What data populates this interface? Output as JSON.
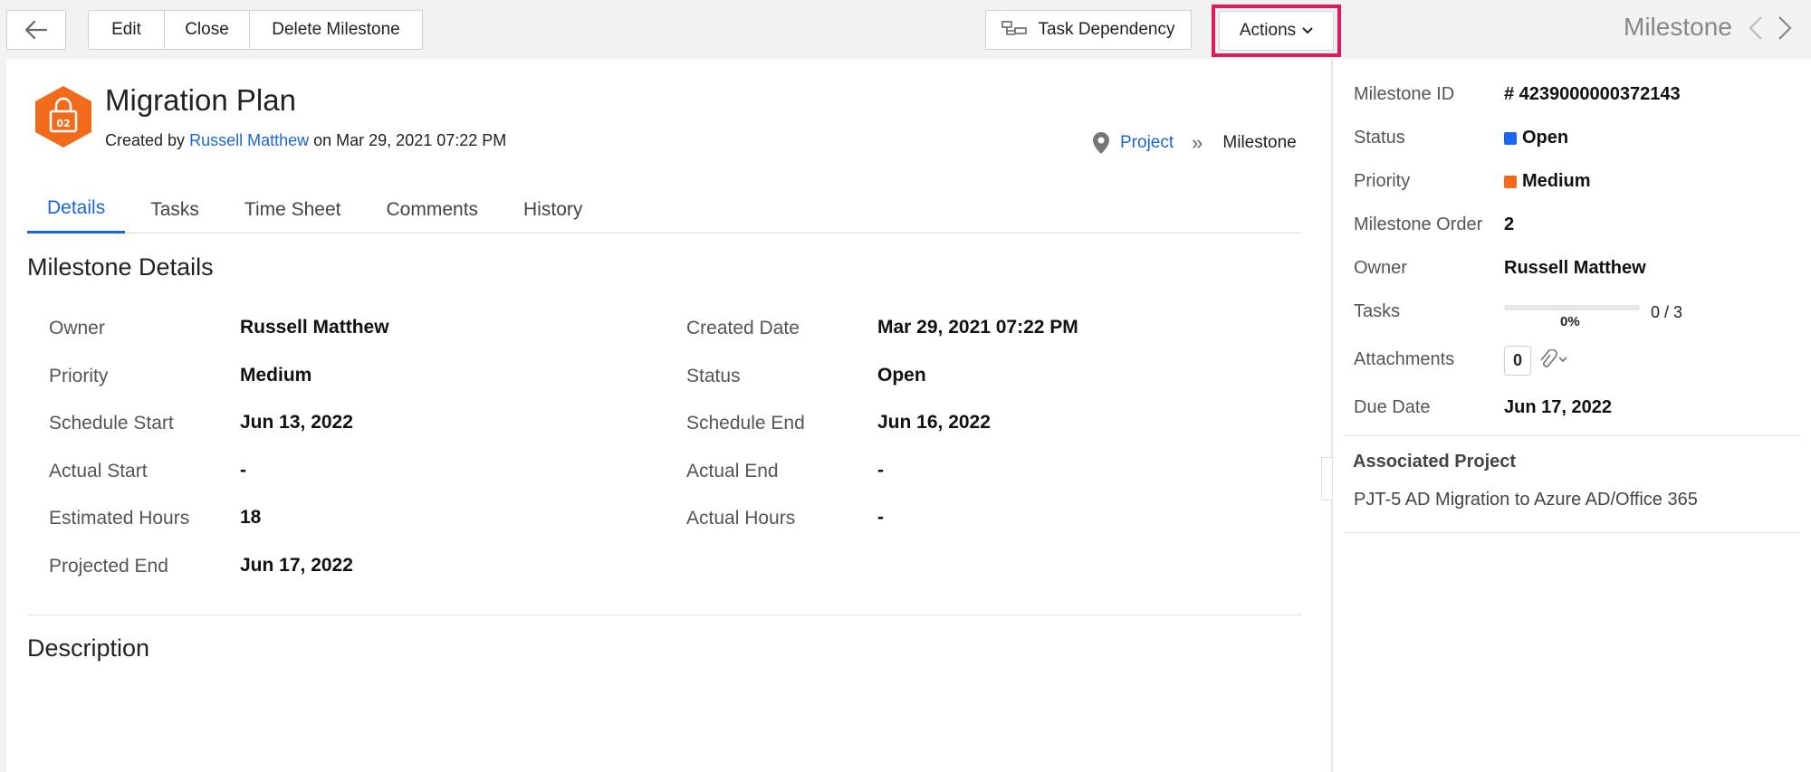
{
  "toolbar": {
    "edit_label": "Edit",
    "close_label": "Close",
    "delete_label": "Delete Milestone",
    "task_dependency_label": "Task Dependency",
    "actions_label": "Actions",
    "nav_title": "Milestone"
  },
  "header": {
    "logo_text": "02",
    "title": "Migration Plan",
    "created_prefix": "Created by",
    "created_by": "Russell Matthew",
    "created_suffix": "on Mar 29, 2021 07:22 PM",
    "breadcrumb_project": "Project",
    "breadcrumb_sep": "»",
    "breadcrumb_current": "Milestone"
  },
  "tabs": [
    {
      "label": "Details",
      "active": true
    },
    {
      "label": "Tasks"
    },
    {
      "label": "Time Sheet"
    },
    {
      "label": "Comments"
    },
    {
      "label": "History"
    }
  ],
  "details": {
    "section_title": "Milestone Details",
    "left": [
      {
        "label": "Owner",
        "value": "Russell Matthew"
      },
      {
        "label": "Priority",
        "value": "Medium"
      },
      {
        "label": "Schedule Start",
        "value": "Jun 13, 2022"
      },
      {
        "label": "Actual Start",
        "value": "-"
      },
      {
        "label": "Estimated Hours",
        "value": "18"
      },
      {
        "label": "Projected End",
        "value": "Jun 17, 2022"
      }
    ],
    "right": [
      {
        "label": "Created Date",
        "value": "Mar 29, 2021 07:22 PM"
      },
      {
        "label": "Status",
        "value": "Open"
      },
      {
        "label": "Schedule End",
        "value": "Jun 16, 2022"
      },
      {
        "label": "Actual End",
        "value": "-"
      },
      {
        "label": "Actual Hours",
        "value": "-"
      }
    ],
    "description_title": "Description"
  },
  "side": {
    "milestone_id_label": "Milestone ID",
    "milestone_id": "# 4239000000372143",
    "status_label": "Status",
    "status": "Open",
    "status_color": "#1a66f0",
    "priority_label": "Priority",
    "priority": "Medium",
    "priority_color": "#f26a1b",
    "order_label": "Milestone Order",
    "order": "2",
    "owner_label": "Owner",
    "owner": "Russell Matthew",
    "tasks_label": "Tasks",
    "tasks_progress": 0,
    "tasks_pct": "0%",
    "tasks_count": "0 / 3",
    "attachments_label": "Attachments",
    "attachments": "0",
    "due_label": "Due Date",
    "due": "Jun 17, 2022",
    "assoc_title": "Associated Project",
    "assoc_value": "PJT-5 AD Migration to Azure AD/Office 365"
  },
  "colors": {
    "accent": "#1a66d6",
    "highlight": "#e8175d",
    "logo": "#f26a1b"
  }
}
